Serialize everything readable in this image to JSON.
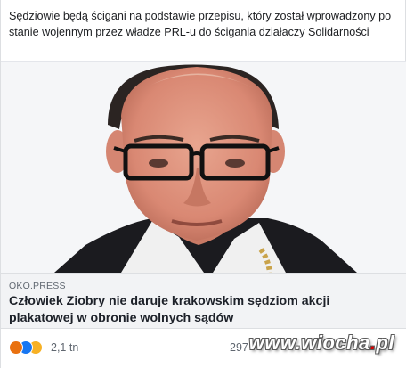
{
  "post": {
    "text": "Sędziowie będą ścigani na podstawie przepisu, który został wprowadzony po stanie wojennym przez władze PRL-u do ścigania działaczy Solidarności"
  },
  "link_preview": {
    "domain": "OKO.PRESS",
    "title": "Człowiek Ziobry nie daruje krakowskim sędziom akcji plakatowej w obronie wolnych sądów"
  },
  "reactions": {
    "icons": [
      "angry-reaction-icon",
      "like-reaction-icon",
      "sad-reaction-icon"
    ],
    "count": "2,1 tn",
    "comments_partial": "297",
    "colors": {
      "angry": "#e9710f",
      "like": "#1877f2",
      "sad": "#f7b125"
    }
  },
  "watermark": {
    "prefix": "www.wiocha",
    "dot": ".",
    "suffix": "pl"
  },
  "colors": {
    "text": "#1c1e21",
    "preview_bg": "#f2f3f5",
    "muted": "#606770"
  }
}
